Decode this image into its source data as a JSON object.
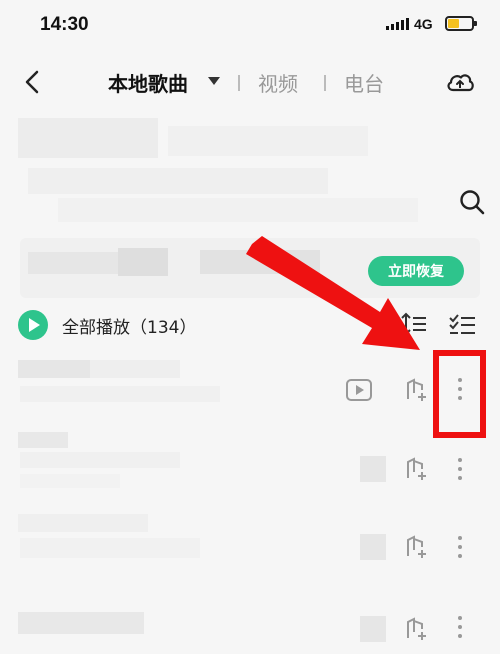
{
  "status_bar": {
    "time": "14:30",
    "network": "4G",
    "battery_level": 0.45,
    "battery_color": "#f4c01e"
  },
  "header": {
    "tabs": [
      {
        "label": "本地歌曲",
        "active": true
      },
      {
        "label": "视频",
        "active": false
      },
      {
        "label": "电台",
        "active": false
      }
    ],
    "back_icon": "chevron-left-icon",
    "cloud_icon": "cloud-sync-icon"
  },
  "search": {
    "icon": "search-icon"
  },
  "restore": {
    "button_label": "立即恢复",
    "accent": "#2ec48c"
  },
  "list": {
    "play_all_label": "全部播放（134）",
    "sort_icon": "sort-icon",
    "multi_select_icon": "multi-select-icon"
  },
  "songs": [
    {
      "has_video": true
    },
    {
      "has_video": false
    },
    {
      "has_video": false
    },
    {
      "has_video": false
    }
  ],
  "annotation": {
    "color": "#ee1111"
  }
}
